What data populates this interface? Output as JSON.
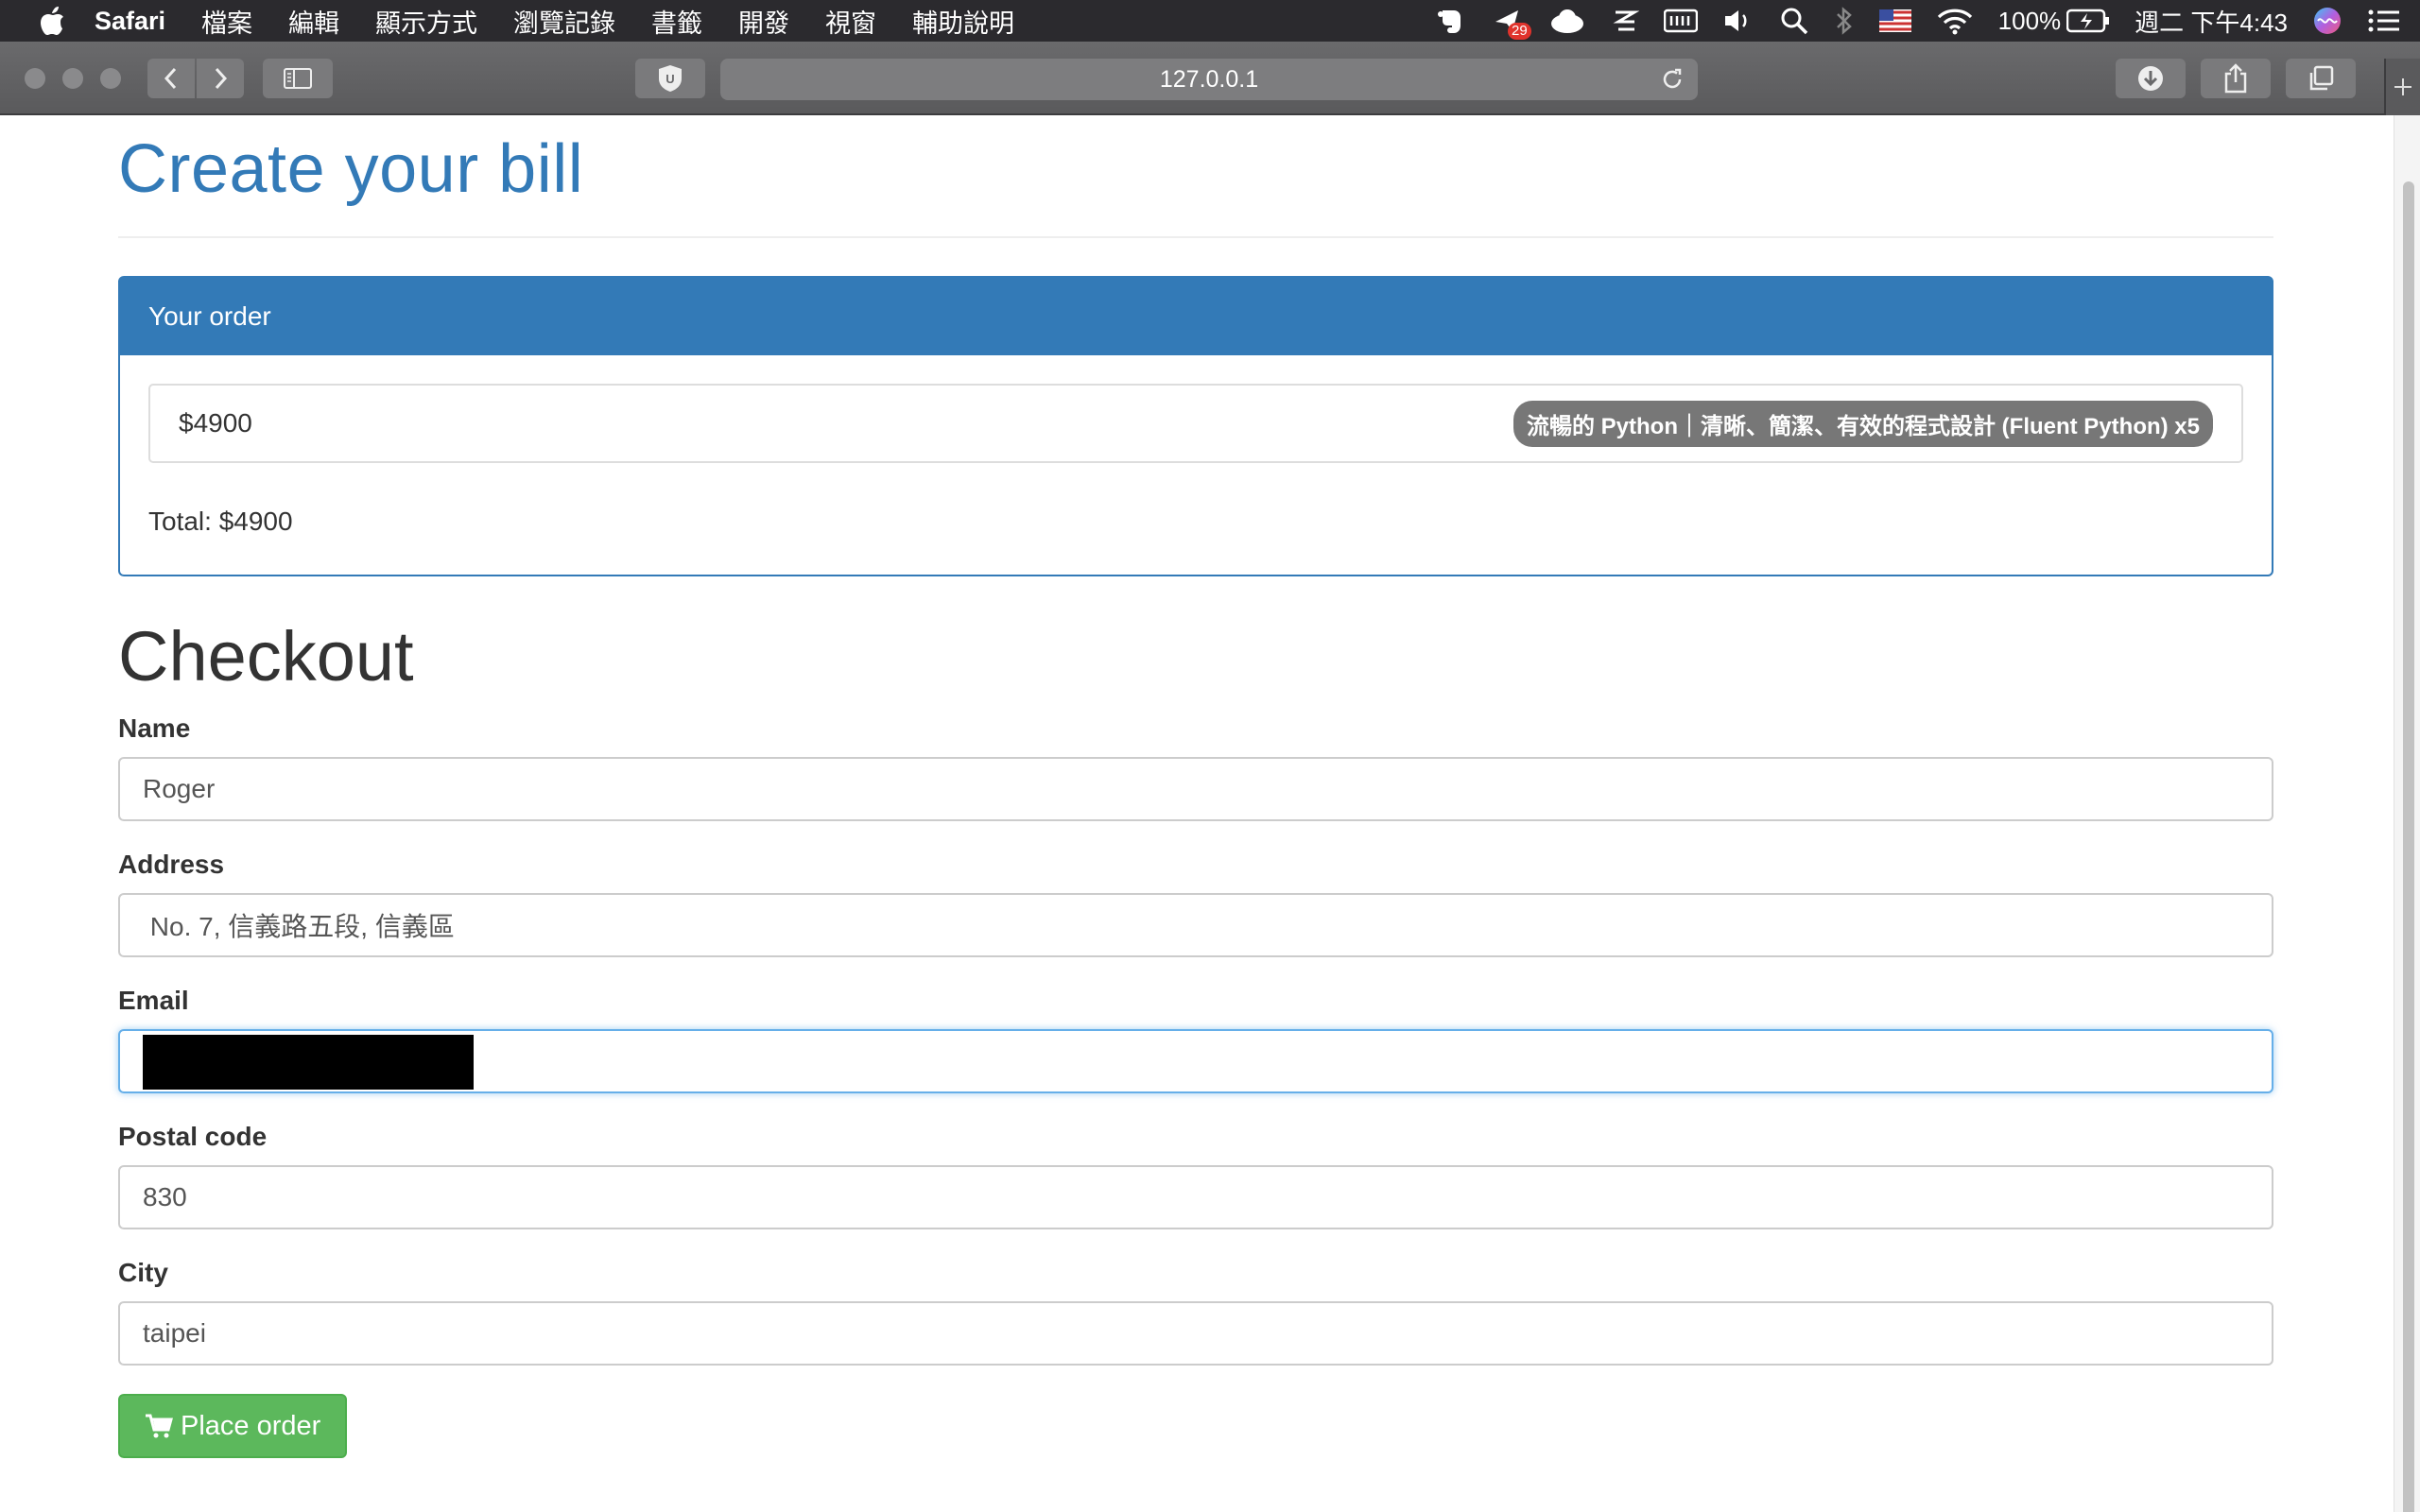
{
  "menubar": {
    "app_name": "Safari",
    "items": [
      "檔案",
      "編輯",
      "顯示方式",
      "瀏覽記錄",
      "書籤",
      "開發",
      "視窗",
      "輔助說明"
    ],
    "notification_count": "29",
    "battery": "100%",
    "clock": "週二 下午4:43"
  },
  "browser": {
    "url": "127.0.0.1",
    "extension_letter": "U"
  },
  "page": {
    "title": "Create your bill",
    "order_panel": {
      "heading": "Your order",
      "items": [
        {
          "price": "$4900",
          "name": "流暢的 Python｜清晰、簡潔、有效的程式設計 (Fluent Python) x5"
        }
      ],
      "total": "Total: $4900"
    },
    "checkout": {
      "heading": "Checkout",
      "fields": {
        "name": {
          "label": "Name",
          "value": "Roger"
        },
        "address": {
          "label": "Address",
          "value": " No. 7, 信義路五段, 信義區"
        },
        "email": {
          "label": "Email",
          "value": ""
        },
        "postal_code": {
          "label": "Postal code",
          "value": "830"
        },
        "city": {
          "label": "City",
          "value": "taipei"
        }
      },
      "submit_label": "Place order"
    }
  },
  "colors": {
    "primary": "#337ab7",
    "success": "#5cb85c",
    "badge": "#777777"
  }
}
